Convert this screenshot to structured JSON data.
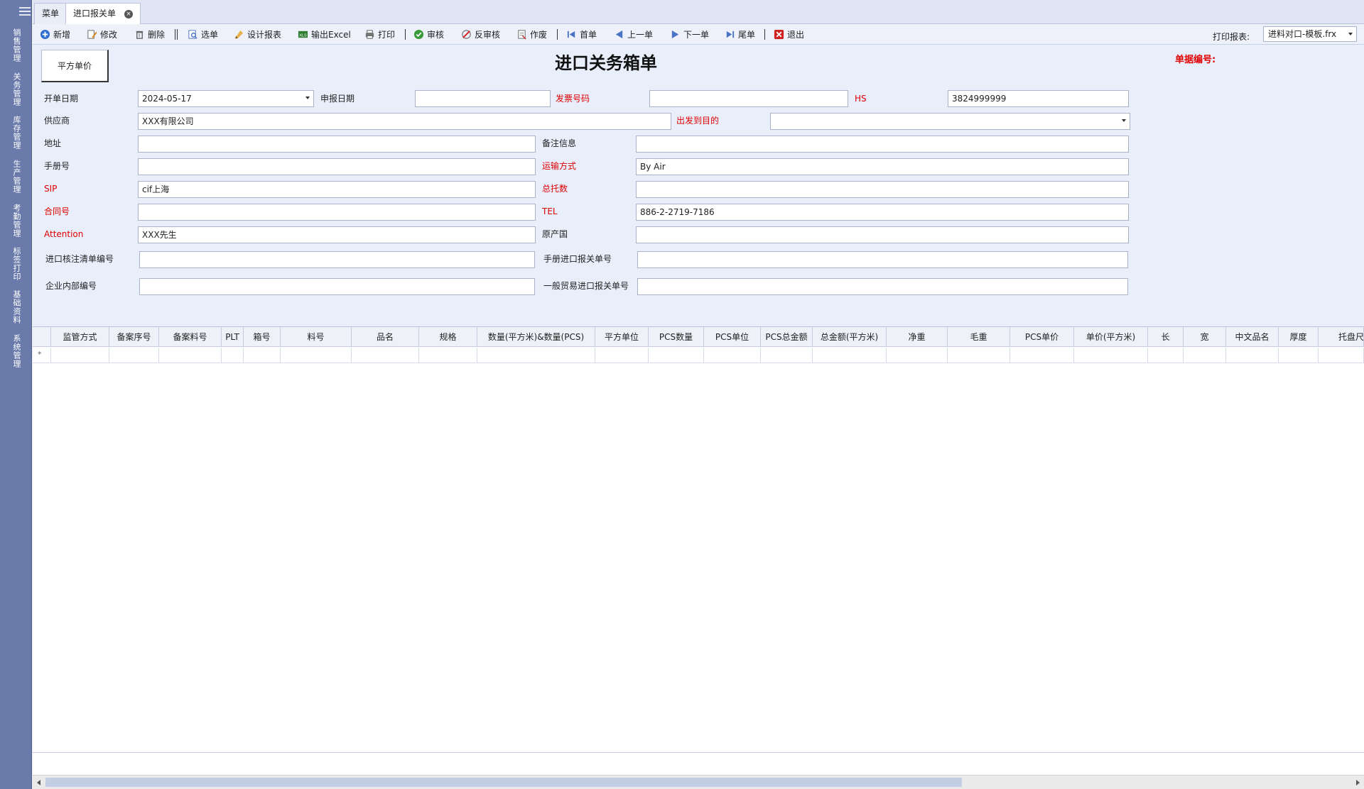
{
  "sidebar": {
    "items": [
      "销售管理",
      "关务管理",
      "库存管理",
      "生产管理",
      "考勤管理",
      "标签打印",
      "基础资料",
      "系统管理"
    ]
  },
  "tabs": [
    {
      "label": "菜单"
    },
    {
      "label": "进口报关单",
      "close": "×"
    }
  ],
  "toolbar": {
    "buttons": [
      "新增",
      "修改",
      "删除",
      "选单",
      "设计报表",
      "输出Excel",
      "打印",
      "审核",
      "反审核",
      "作废",
      "首单",
      "上一单",
      "下一单",
      "尾单",
      "退出"
    ],
    "print_label": "打印报表:",
    "print_template": "进料对口-模板.frx",
    "colors": {
      "new": "#2f6fcf",
      "approve": "#3a9a3a",
      "exit": "#d02020"
    }
  },
  "form": {
    "price_button": "平方单价",
    "title": "进口关务箱单",
    "doc_no_label": "单据编号:",
    "fields": {
      "open_date": {
        "label": "开单日期",
        "value": "2024-05-17"
      },
      "declare_date": {
        "label": "申报日期",
        "value": ""
      },
      "invoice_no": {
        "label": "发票号码",
        "value": ""
      },
      "hs": {
        "label": "HS",
        "value": "3824999999"
      },
      "supplier": {
        "label": "供应商",
        "value": "XXX有限公司"
      },
      "origin_dest": {
        "label": "出发到目的",
        "value": ""
      },
      "address": {
        "label": "地址",
        "value": ""
      },
      "remarks": {
        "label": "备注信息",
        "value": ""
      },
      "manual_no": {
        "label": "手册号",
        "value": ""
      },
      "transport": {
        "label": "运输方式",
        "value": "By Air"
      },
      "sip": {
        "label": "SIP",
        "value": "cif上海"
      },
      "total_pallets": {
        "label": "总托数",
        "value": ""
      },
      "contract_no": {
        "label": "合同号",
        "value": ""
      },
      "tel": {
        "label": "TEL",
        "value": "886-2-2719-7186"
      },
      "attention": {
        "label": "Attention",
        "value": "XXX先生"
      },
      "origin_country": {
        "label": "原产国",
        "value": ""
      },
      "import_check_no": {
        "label": "进口核注清单编号",
        "value": ""
      },
      "manual_import_no": {
        "label": "手册进口报关单号",
        "value": ""
      },
      "internal_no": {
        "label": "企业内部编号",
        "value": ""
      },
      "general_import_no": {
        "label": "一般贸易进口报关单号",
        "value": ""
      }
    },
    "required_color": "#e00000"
  },
  "grid": {
    "columns": [
      "监管方式",
      "备案序号",
      "备案料号",
      "PLT",
      "箱号",
      "料号",
      "品名",
      "规格",
      "数量(平方米)&数量(PCS)",
      "平方单位",
      "PCS数量",
      "PCS单位",
      "PCS总金额",
      "总金额(平方米)",
      "净重",
      "毛重",
      "PCS单价",
      "单价(平方米)",
      "长",
      "宽",
      "中文品名",
      "厚度",
      "托盘尺"
    ],
    "new_row_marker": "*"
  }
}
